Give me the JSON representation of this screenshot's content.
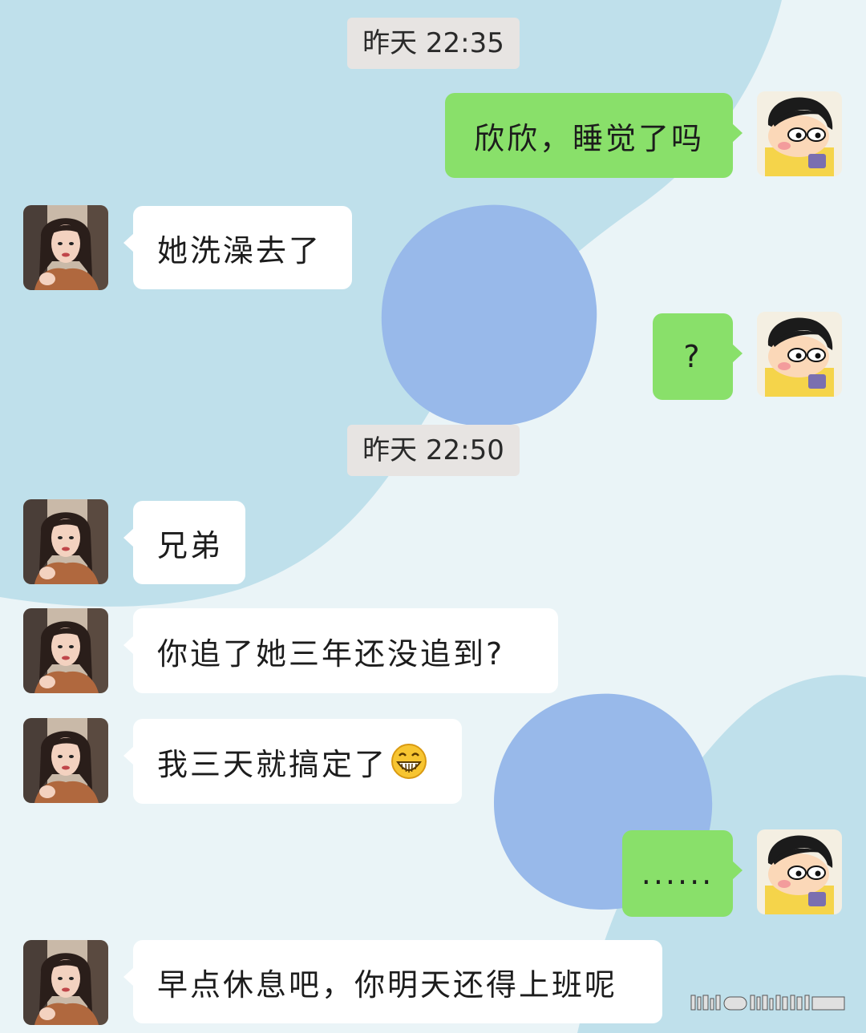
{
  "chat": {
    "timestamps": [
      "昨天 22:35",
      "昨天 22:50"
    ],
    "messages": [
      {
        "sender": "self",
        "text": "欣欣，睡觉了吗"
      },
      {
        "sender": "other",
        "text": "她洗澡去了"
      },
      {
        "sender": "self",
        "text": "?"
      },
      {
        "sender": "other",
        "text": "兄弟"
      },
      {
        "sender": "other",
        "text": "你追了她三年还没追到?"
      },
      {
        "sender": "other",
        "text": "我三天就搞定了",
        "emoji": "grinning-face-emoji"
      },
      {
        "sender": "self",
        "text": "......"
      },
      {
        "sender": "other",
        "text": "早点休息吧，你明天还得上班呢"
      }
    ]
  },
  "colors": {
    "outgoing_bubble": "#89e06a",
    "incoming_bubble": "#ffffff",
    "timestamp_bg": "#e7e4e2",
    "background_light": "#eaf4f7",
    "background_blue": "#bfe0eb",
    "blob_blue": "#98b9ea"
  },
  "icons": {
    "self_avatar": "cartoon-boy-avatar-icon",
    "other_avatar": "woman-portrait-avatar-icon",
    "emoji": "grinning-face-emoji"
  }
}
